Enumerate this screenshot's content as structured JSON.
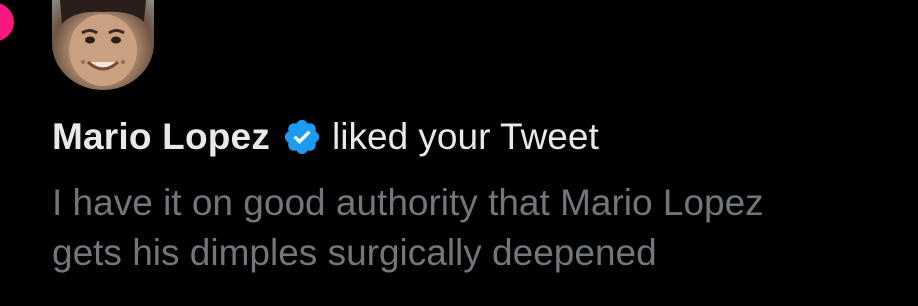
{
  "notification": {
    "user_name": "Mario Lopez",
    "verified_icon": "verified-badge-icon",
    "action": "liked your Tweet",
    "tweet_lines": [
      "I have it on good authority that Mario Lopez",
      "gets his dimples surgically deepened"
    ]
  },
  "colors": {
    "background": "#000000",
    "like_heart": "#f91880",
    "verified_badge": "#1d9bf0",
    "name_text": "#e7e9ea",
    "tweet_text": "#71767b"
  }
}
